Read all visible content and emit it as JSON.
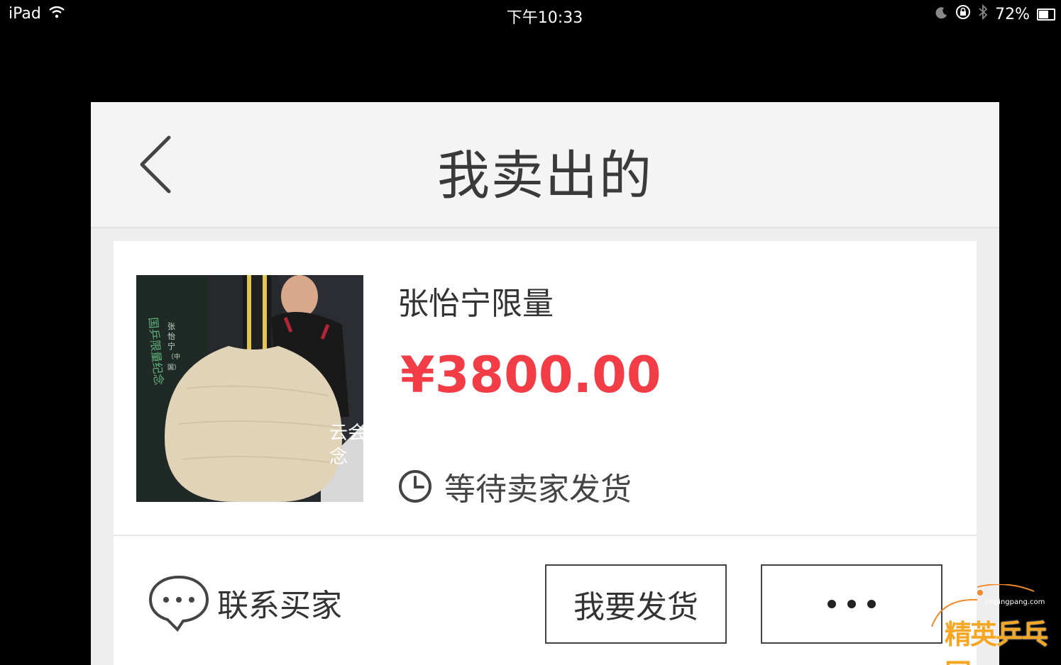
{
  "status_bar": {
    "device": "iPad",
    "time": "下午10:33",
    "battery": "72%",
    "battery_level": 0.72
  },
  "nav": {
    "title": "我卖出的"
  },
  "order": {
    "title": "张怡宁限量",
    "price": "¥3800.00",
    "status": "等待卖家发货",
    "contact_label": "联系买家",
    "ship_button": "我要发货"
  },
  "thumb": {
    "caption_lines": [
      "张",
      "怡",
      "宁",
      "（中国）"
    ],
    "side_text": "云会\n念"
  },
  "watermark": {
    "site": "cnpingpang.com",
    "label": "精英乒乓网"
  },
  "colors": {
    "price": "#f23d47",
    "nav_bg": "#f4f4f4",
    "card_bg": "#ffffff"
  }
}
